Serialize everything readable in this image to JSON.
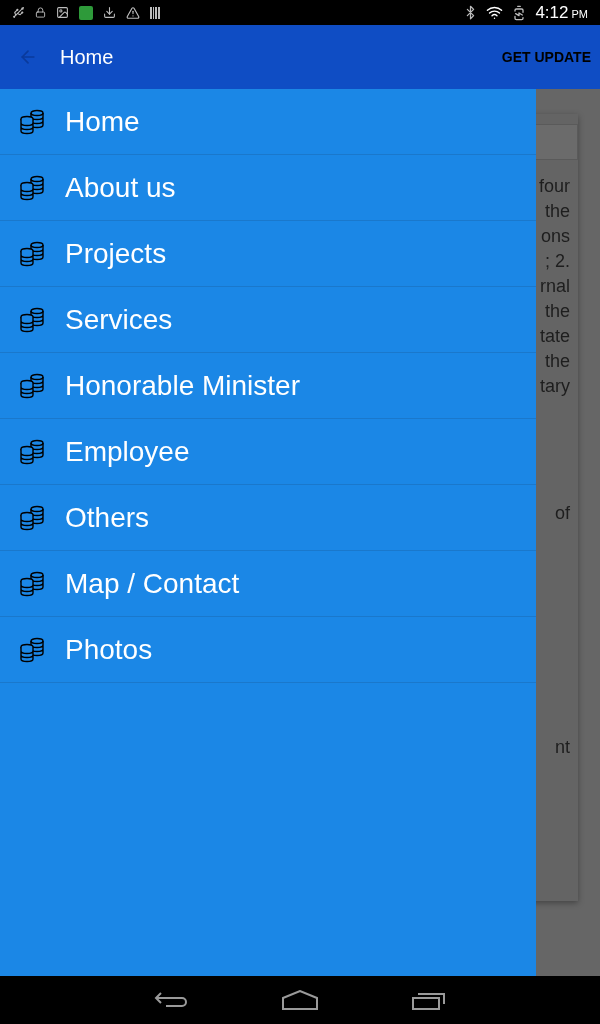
{
  "status_bar": {
    "time": "4:12",
    "period": "PM"
  },
  "app_bar": {
    "title": "Home",
    "action": "GET UPDATE"
  },
  "drawer": {
    "items": [
      {
        "label": "Home"
      },
      {
        "label": "About us"
      },
      {
        "label": "Projects"
      },
      {
        "label": "Services"
      },
      {
        "label": "Honorable Minister"
      },
      {
        "label": "Employee"
      },
      {
        "label": "Others"
      },
      {
        "label": "Map / Contact"
      },
      {
        "label": "Photos"
      }
    ]
  },
  "background_content": {
    "paragraphs": [
      [
        "four",
        "the",
        "ons",
        "; 2.",
        "rnal",
        "the",
        "tate",
        "the",
        "tary"
      ],
      [
        "of"
      ],
      [
        "nt"
      ]
    ]
  }
}
